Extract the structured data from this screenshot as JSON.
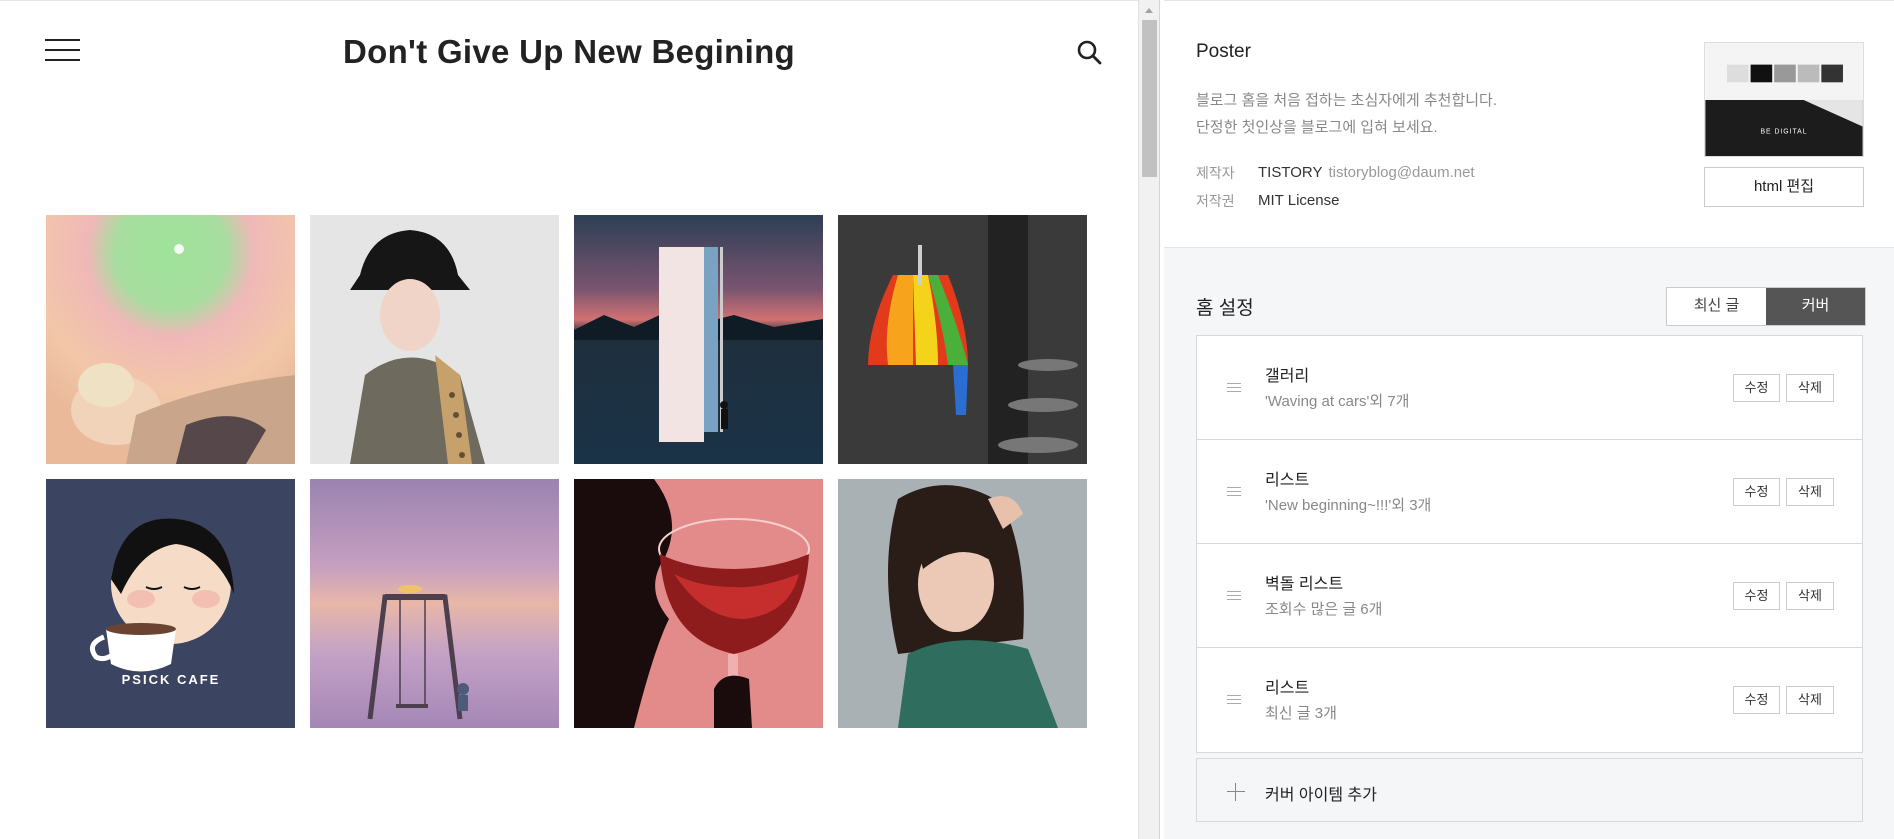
{
  "preview": {
    "blog_title": "Don't Give Up New Begining",
    "icons": {
      "menu": "hamburger-menu-icon",
      "search": "search-icon"
    },
    "gallery_image_count": 8,
    "psick_label": "PSICK CAFE"
  },
  "skin": {
    "name": "Poster",
    "desc_line1": "블로그 홈을 처음 접하는 초심자에게 추천합니다.",
    "desc_line2": "단정한 첫인상을 블로그에 입혀 보세요.",
    "maker_key": "제작자",
    "maker_val": "TISTORY",
    "maker_email": "tistoryblog@daum.net",
    "license_key": "저작권",
    "license_val": "MIT License",
    "html_edit_label": "html 편집",
    "thumb_text": "BE DIGITAL"
  },
  "home": {
    "title": "홈 설정",
    "tabs": [
      {
        "label": "최신 글",
        "active": false
      },
      {
        "label": "커버",
        "active": true
      }
    ],
    "items": [
      {
        "title": "갤러리",
        "subtitle": "'Waving at cars'외 7개",
        "edit": "수정",
        "delete": "삭제"
      },
      {
        "title": "리스트",
        "subtitle": "'New beginning~!!!'외 3개",
        "edit": "수정",
        "delete": "삭제"
      },
      {
        "title": "벽돌 리스트",
        "subtitle": "조회수 많은 글 6개",
        "edit": "수정",
        "delete": "삭제"
      },
      {
        "title": "리스트",
        "subtitle": "최신 글 3개",
        "edit": "수정",
        "delete": "삭제"
      }
    ],
    "add_label": "커버 아이템 추가"
  },
  "colors": {
    "active_tab_bg": "#555555",
    "panel_bg": "#f5f6f8",
    "border": "#d8d8d8"
  }
}
